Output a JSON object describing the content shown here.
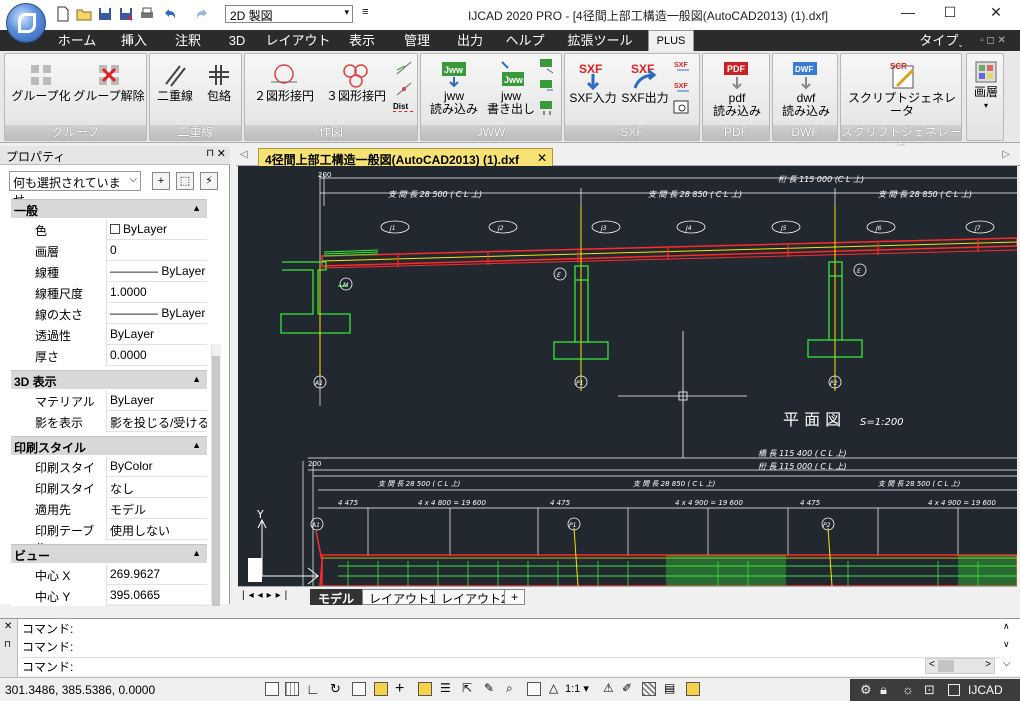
{
  "window": {
    "title": "IJCAD 2020 PRO - [4径間上部工構造一般図(AutoCAD2013) (1).dxf]",
    "workspace": "2D 製図"
  },
  "ribbon_tabs": [
    "ホーム",
    "挿入",
    "注釈",
    "3D",
    "レイアウト",
    "表示",
    "管理",
    "出力",
    "ヘルプ",
    "拡張ツール",
    "PLUS"
  ],
  "ribbon_right": "タイプ˯",
  "ribbon": {
    "groups": {
      "group": "グループ",
      "double_line": "二重線",
      "drawing": "作図",
      "jww": "JWW",
      "sxf": "SXF",
      "pdf": "PDF",
      "dwf": "DWF",
      "script": "スクリプトジェネレータ"
    },
    "buttons": {
      "group_make": "グループ化",
      "group_release": "グループ解除",
      "double_line": "二重線",
      "wrap": "包絡",
      "circle2": "２図形接円",
      "circle3": "３図形接円",
      "dist": "Dist",
      "jww_read_1": "jww",
      "jww_read_2": "読み込み",
      "jww_write_1": "jww",
      "jww_write_2": "書き出し",
      "sxf_in": "SXF入力",
      "sxf_out": "SXF出力",
      "pdf_1": "pdf",
      "pdf_2": "読み込み",
      "dwf_1": "dwf",
      "dwf_2": "読み込み",
      "script": "スクリプトジェネレータ",
      "layer": "画層"
    },
    "icon_text": {
      "jww": "Jww",
      "sxf": "SXF",
      "pdf": "PDF",
      "dwf": "DWF",
      "sch": "SCR"
    }
  },
  "properties": {
    "title": "プロパティ",
    "selection": "何も選択されていませ...",
    "sections": [
      {
        "name": "一般",
        "rows": [
          {
            "key": "色",
            "value": "ByLayer"
          },
          {
            "key": "画層",
            "value": "0"
          },
          {
            "key": "線種",
            "value": "———— ByLayer"
          },
          {
            "key": "線種尺度",
            "value": "1.0000"
          },
          {
            "key": "線の太さ",
            "value": "———— ByLayer"
          },
          {
            "key": "透過性",
            "value": "ByLayer"
          },
          {
            "key": "厚さ",
            "value": "0.0000"
          }
        ]
      },
      {
        "name": "3D 表示",
        "rows": [
          {
            "key": "マテリアル",
            "value": "ByLayer"
          },
          {
            "key": "影を表示",
            "value": "影を投じる/受ける"
          }
        ]
      },
      {
        "name": "印刷スタイル",
        "rows": [
          {
            "key": "印刷スタイル",
            "value": "ByColor"
          },
          {
            "key": "印刷スタイル ...",
            "value": "なし"
          },
          {
            "key": "適用先",
            "value": "モデル"
          },
          {
            "key": "印刷テーブル...",
            "value": "使用しない"
          }
        ]
      },
      {
        "name": "ビュー",
        "rows": [
          {
            "key": "中心 X",
            "value": "269.9627"
          },
          {
            "key": "中心 Y",
            "value": "395.0665"
          }
        ]
      }
    ]
  },
  "document_tab": "4径間上部工構造一般図(AutoCAD2013) (1).dxf",
  "drawing_text": {
    "girder_length": "桁  長  115 000 (C L 上)",
    "span1": "支 間 長   28 500 ( C L 上)",
    "span2": "支 間 長   28 850 ( C L 上)",
    "span3": "支 間 長   28 850 ( C L 上)",
    "span4": "支 間 長   28 500 ( C L 上)",
    "plan_title": "平 面 図",
    "plan_scale": "S=1:200",
    "bridge_length": "橋  長  115 400 ( C L 上)",
    "girder_length2": "桁  長  115 000 ( C L 上)",
    "j_labels": [
      "J1",
      "J2",
      "J3",
      "J4",
      "J5",
      "J6",
      "J7"
    ],
    "pier_labels": [
      "A1",
      "P1",
      "P2"
    ],
    "bearing_labels": [
      "M",
      "E",
      "E"
    ],
    "dim_200": "200",
    "seg_a": "4 475",
    "seg_b": "4 x 4 800 = 19 600",
    "seg_c": "4 x 4 900 = 19 600",
    "y_axis": "Y"
  },
  "layout_tabs": [
    "モデル",
    "レイアウト1",
    "レイアウト2",
    "+"
  ],
  "command": {
    "lines": [
      "コマンド:",
      "コマンド:",
      "コマンド:"
    ]
  },
  "status": {
    "coords": "301.3486, 385.5386, 0.0000",
    "scale": "1:1",
    "product": "IJCAD"
  }
}
